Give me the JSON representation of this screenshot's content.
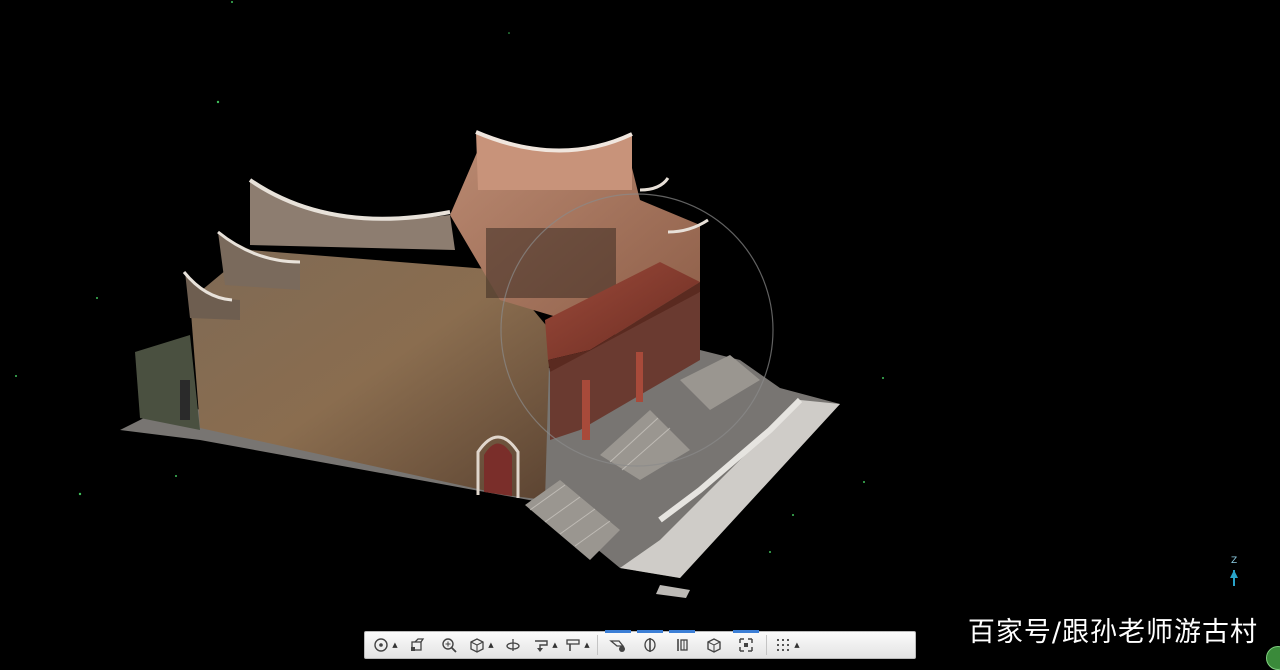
{
  "watermark": {
    "text": "百家号/跟孙老师游古村"
  },
  "axis": {
    "label": "Z",
    "color": "#29a3c9"
  },
  "viewport": {
    "background": "#000000",
    "content": "point-cloud-ancestral-hall"
  },
  "toolbar": {
    "buttons": [
      {
        "name": "orbit-mode",
        "icon": "orbit-icon",
        "has_dropdown": true,
        "active": false
      },
      {
        "name": "pan",
        "icon": "pan-icon",
        "has_dropdown": false,
        "active": false
      },
      {
        "name": "zoom",
        "icon": "zoom-icon",
        "has_dropdown": false,
        "active": false
      },
      {
        "name": "view-cube",
        "icon": "cube-view-icon",
        "has_dropdown": true,
        "active": false
      },
      {
        "name": "rotate",
        "icon": "rotate-icon",
        "has_dropdown": false,
        "active": false
      },
      {
        "name": "measure",
        "icon": "measure-icon",
        "has_dropdown": true,
        "active": false
      },
      {
        "name": "section",
        "icon": "section-icon",
        "has_dropdown": true,
        "active": false
      },
      {
        "name": "point-filter",
        "icon": "filter-icon",
        "has_dropdown": false,
        "active": true
      },
      {
        "name": "clip-plane",
        "icon": "clip-icon",
        "has_dropdown": false,
        "active": true
      },
      {
        "name": "slice",
        "icon": "slice-icon",
        "has_dropdown": false,
        "active": true
      },
      {
        "name": "box-clip",
        "icon": "box-icon",
        "has_dropdown": false,
        "active": false
      },
      {
        "name": "fit-view",
        "icon": "fit-icon",
        "has_dropdown": false,
        "active": true
      },
      {
        "name": "more-tools",
        "icon": "grid-icon",
        "has_dropdown": true,
        "active": false
      }
    ]
  }
}
